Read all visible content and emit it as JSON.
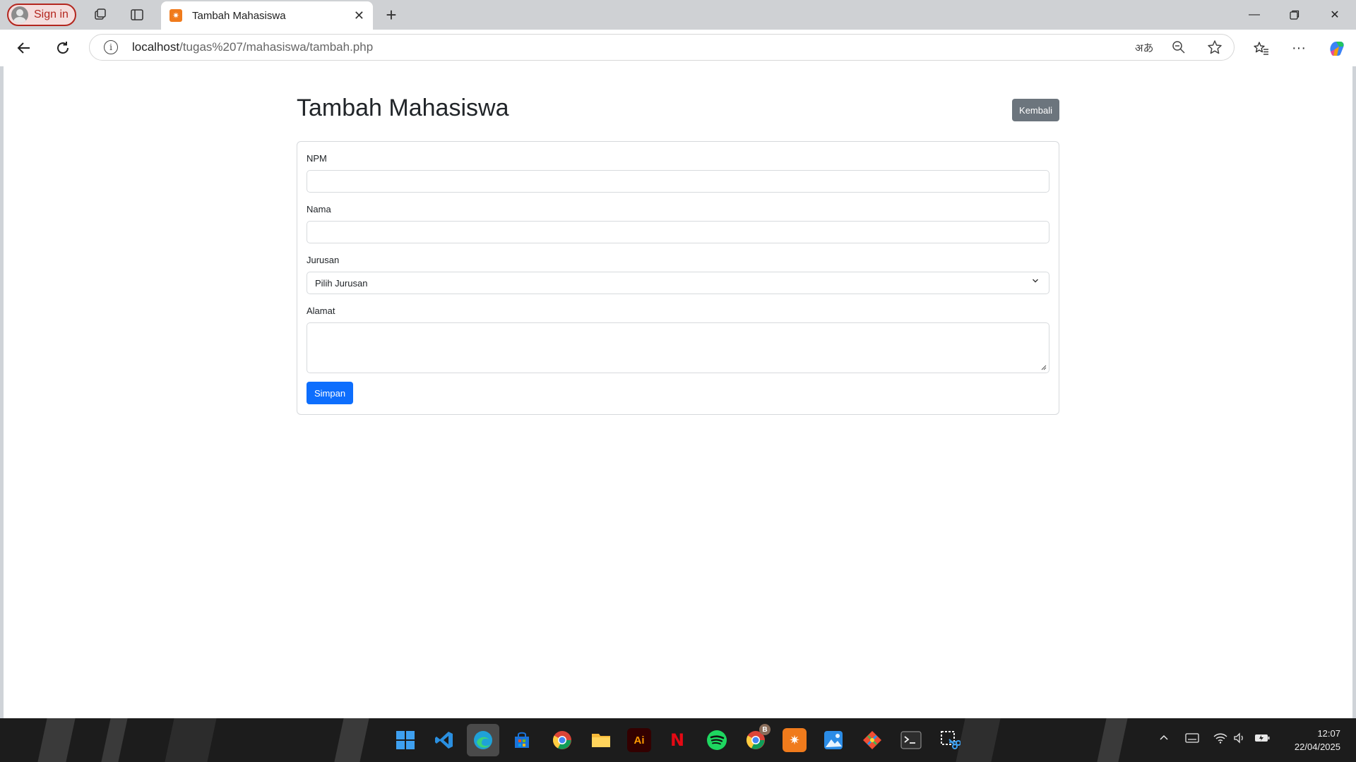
{
  "browser": {
    "signin_label": "Sign in",
    "tab_title": "Tambah Mahasiswa",
    "favicon_glyph": "✷",
    "url_host": "localhost",
    "url_path": "/tugas%207/mahasiswa/tambah.php",
    "translate_glyph": "अあ"
  },
  "page": {
    "title": "Tambah Mahasiswa",
    "back_label": "Kembali",
    "form": {
      "npm_label": "NPM",
      "npm_value": "",
      "nama_label": "Nama",
      "nama_value": "",
      "jurusan_label": "Jurusan",
      "jurusan_selected": "Pilih Jurusan",
      "alamat_label": "Alamat",
      "alamat_value": "",
      "submit_label": "Simpan"
    }
  },
  "colors": {
    "primary": "#0d6efd",
    "secondary": "#6c757d",
    "signin_accent": "#b3261e"
  },
  "taskbar": {
    "time": "12:07",
    "date": "22/04/2025",
    "chrome_badge": "B",
    "illustrator_label": "Ai",
    "netflix_label": "N",
    "apps": [
      "start",
      "vscode",
      "edge",
      "store",
      "chrome",
      "files",
      "illustrator",
      "netflix",
      "spotify",
      "chrome-profile",
      "xampp",
      "photos",
      "git",
      "terminal",
      "snipping-tool"
    ]
  }
}
